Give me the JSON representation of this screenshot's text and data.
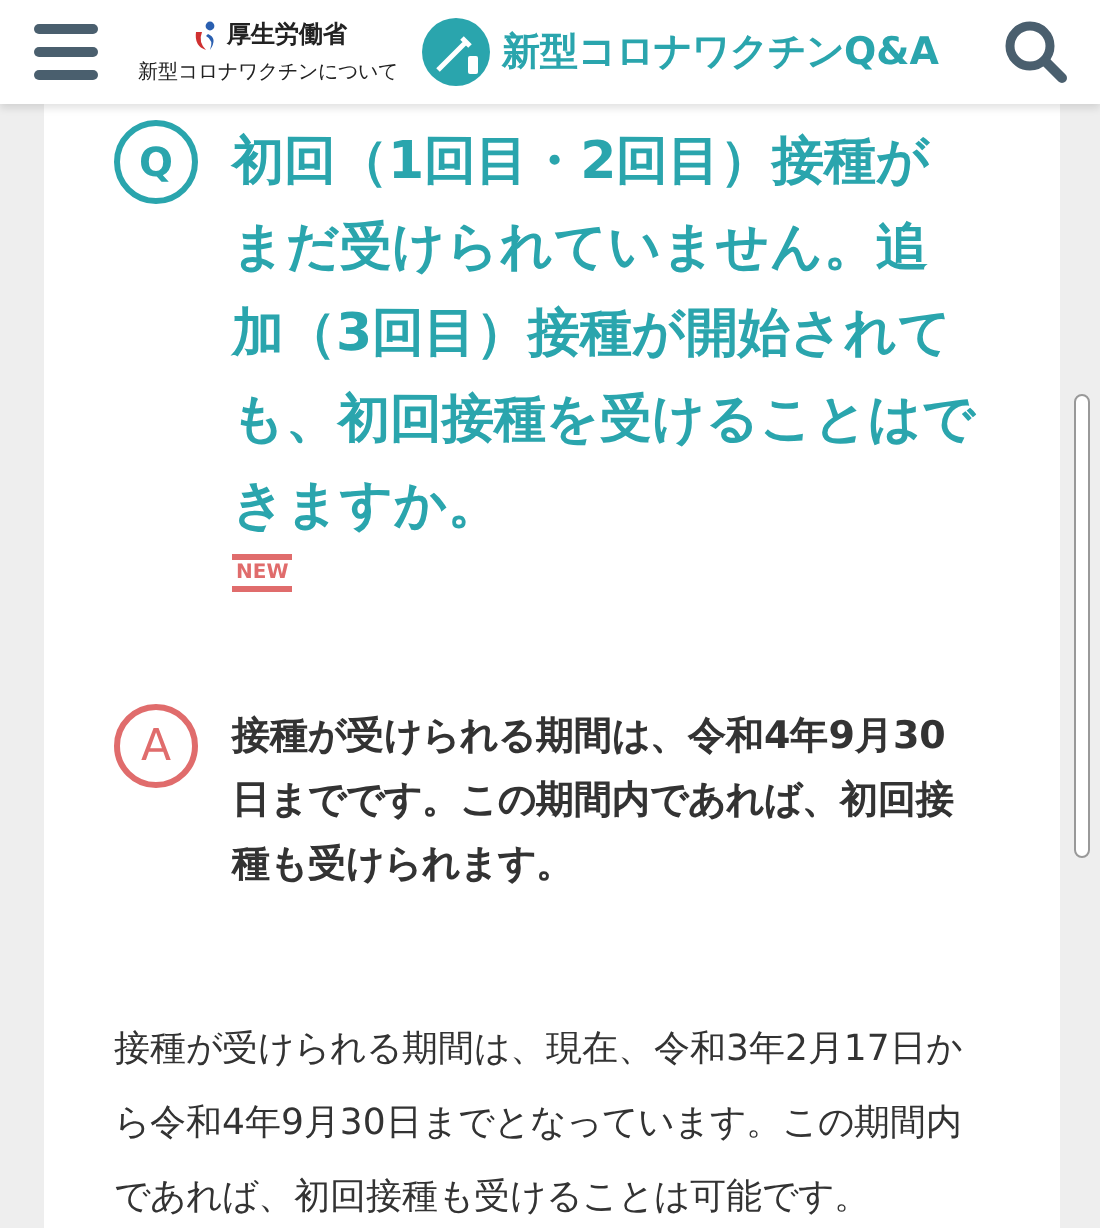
{
  "header": {
    "ministry_name": "厚生労働省",
    "ministry_subtitle": "新型コロナワクチンについて",
    "site_title": "新型コロナワクチンQ&A"
  },
  "question": {
    "mark": "Q",
    "text": "初回（1回目・2回目）接種がまだ受けられていません。追加（3回目）接種が開始されても、初回接種を受けることはできますか。",
    "badge": "NEW"
  },
  "answer": {
    "mark": "A",
    "text": "接種が受けられる期間は、令和4年9月30日までです。この期間内であれば、初回接種も受けられます。"
  },
  "explanation": "接種が受けられる期間は、現在、令和3年2月17日から令和4年9月30日までとなっています。この期間内であれば、初回接種も受けることは可能です。"
}
